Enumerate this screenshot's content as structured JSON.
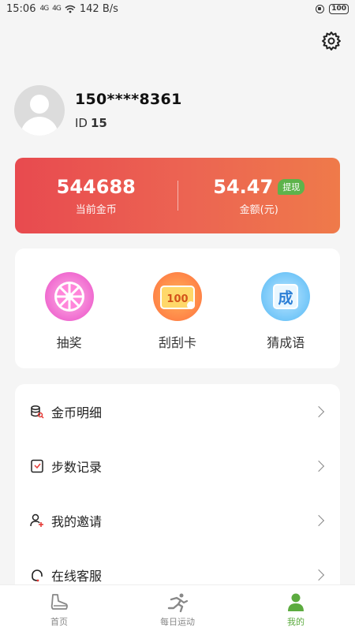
{
  "status_bar": {
    "time": "15:06",
    "signal1": "4G",
    "signal2": "4G",
    "network_speed": "142 B/s",
    "battery": "100"
  },
  "header": {
    "settings_icon": "gear-icon"
  },
  "profile": {
    "phone": "150****8361",
    "id_label": "ID",
    "id_value": "15"
  },
  "wallet": {
    "coins_value": "544688",
    "coins_label": "当前金币",
    "amount_value": "54.47",
    "amount_label": "金额(元)",
    "withdraw_label": "提现"
  },
  "games": [
    {
      "label": "抽奖",
      "icon": "wheel-icon"
    },
    {
      "label": "刮刮卡",
      "icon": "scratch-card-icon",
      "badge": "100"
    },
    {
      "label": "猜成语",
      "icon": "idiom-icon",
      "badge": "成"
    }
  ],
  "menu": [
    {
      "label": "金币明细",
      "icon": "coin-detail-icon"
    },
    {
      "label": "步数记录",
      "icon": "step-record-icon"
    },
    {
      "label": "我的邀请",
      "icon": "invite-icon"
    },
    {
      "label": "在线客服",
      "icon": "customer-service-icon"
    }
  ],
  "tabs": [
    {
      "label": "首页",
      "icon": "shoe-icon",
      "active": false
    },
    {
      "label": "每日运动",
      "icon": "runner-icon",
      "active": false
    },
    {
      "label": "我的",
      "icon": "user-icon",
      "active": true
    }
  ],
  "colors": {
    "accent_green": "#5cab3f",
    "wallet_gradient_start": "#e84a4f",
    "wallet_gradient_end": "#ef7a4a"
  }
}
